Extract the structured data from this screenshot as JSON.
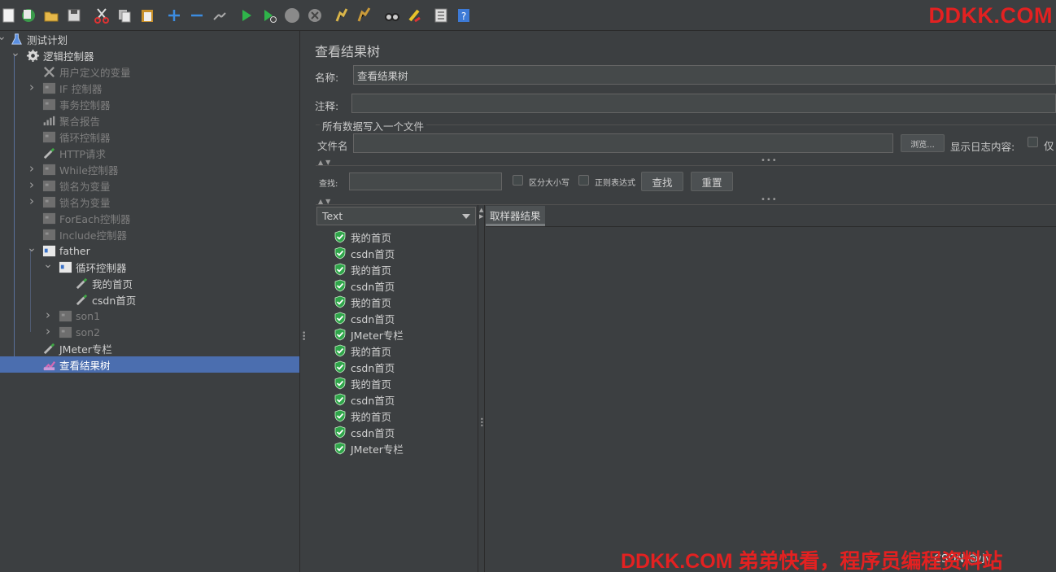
{
  "watermark": {
    "top": "DDKK.COM",
    "bottom": "DDKK.COM 弟弟快看，程序员编程资料站",
    "corner": "CSDN @小"
  },
  "toolbar": {
    "icons": [
      "new-icon",
      "template-icon",
      "open-icon",
      "save-icon",
      "cut-icon",
      "copy-icon",
      "paste-icon",
      "expand-icon",
      "collapse-icon",
      "toggle-icon",
      "start-icon",
      "start-no-pause-icon",
      "stop-icon",
      "shutdown-icon",
      "clear-icon",
      "clear-all-icon",
      "search-icon",
      "reset-search-icon",
      "function-helper-icon",
      "help-icon"
    ]
  },
  "tree": {
    "items": [
      {
        "label": "测试计划",
        "icon": "flask-icon",
        "state": "bright"
      },
      {
        "label": "逻辑控制器",
        "icon": "gear-icon",
        "state": "bright"
      },
      {
        "label": "用户定义的变量",
        "icon": "wrench-icon",
        "state": "dim"
      },
      {
        "label": "IF 控制器",
        "icon": "controller-icon",
        "state": "dim"
      },
      {
        "label": "事务控制器",
        "icon": "controller-icon",
        "state": "dim"
      },
      {
        "label": "聚合报告",
        "icon": "chart-icon",
        "state": "dim"
      },
      {
        "label": "循环控制器",
        "icon": "controller-icon",
        "state": "dim"
      },
      {
        "label": "HTTP请求",
        "icon": "pipette-icon",
        "state": "dim"
      },
      {
        "label": "While控制器",
        "icon": "controller-icon",
        "state": "dim"
      },
      {
        "label": "锁名为变量",
        "icon": "controller-icon",
        "state": "dim"
      },
      {
        "label": "锁名为变量",
        "icon": "controller-icon",
        "state": "dim"
      },
      {
        "label": "ForEach控制器",
        "icon": "controller-icon",
        "state": "dim"
      },
      {
        "label": "Include控制器",
        "icon": "controller-icon",
        "state": "dim"
      },
      {
        "label": "father",
        "icon": "controller-active-icon",
        "state": "bright"
      },
      {
        "label": "循环控制器",
        "icon": "controller-active-icon",
        "state": "bright"
      },
      {
        "label": "我的首页",
        "icon": "pipette-icon",
        "state": "bright"
      },
      {
        "label": "csdn首页",
        "icon": "pipette-icon",
        "state": "bright"
      },
      {
        "label": "son1",
        "icon": "controller-icon",
        "state": "dim"
      },
      {
        "label": "son2",
        "icon": "controller-icon",
        "state": "dim"
      },
      {
        "label": "JMeter专栏",
        "icon": "pipette-icon",
        "state": "bright"
      },
      {
        "label": "查看结果树",
        "icon": "listener-icon",
        "state": "bright"
      }
    ]
  },
  "panel": {
    "title": "查看结果树",
    "name_label": "名称:",
    "name_value": "查看结果树",
    "comment_label": "注释:",
    "comment_value": "",
    "file_section_label": "所有数据写入一个文件",
    "filename_label": "文件名",
    "filename_value": "",
    "browse_button": "浏览...",
    "log_label": "显示日志内容:",
    "only_label": "仅",
    "search_label": "查找:",
    "search_value": "",
    "case_label": "区分大小写",
    "regex_label": "正则表达式",
    "find_button": "查找",
    "reset_button": "重置",
    "renderer_value": "Text",
    "tab_label": "取样器结果"
  },
  "results": [
    "我的首页",
    "csdn首页",
    "我的首页",
    "csdn首页",
    "我的首页",
    "csdn首页",
    "JMeter专栏",
    "我的首页",
    "csdn首页",
    "我的首页",
    "csdn首页",
    "我的首页",
    "csdn首页",
    "JMeter专栏"
  ]
}
